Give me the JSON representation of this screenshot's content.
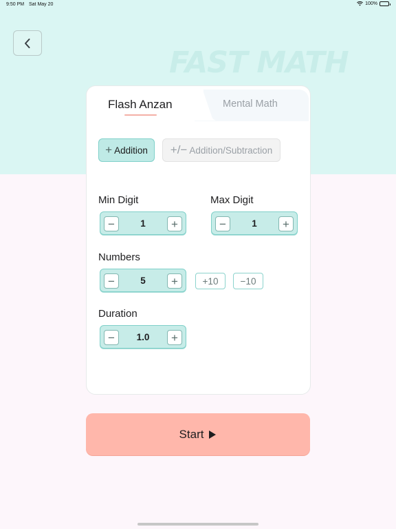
{
  "status_bar": {
    "time": "9:50 PM",
    "date": "Sat May 20",
    "battery": "100%"
  },
  "header": {
    "logo": "FAST MATH"
  },
  "tabs": [
    {
      "label": "Flash Anzan",
      "active": true
    },
    {
      "label": "Mental Math",
      "active": false
    }
  ],
  "modes": {
    "addition": {
      "symbol": "+",
      "label": "Addition",
      "selected": true
    },
    "addition_subtraction": {
      "symbol": "+/−",
      "label": "Addition/Subtraction",
      "selected": false
    }
  },
  "settings": {
    "min_digit": {
      "label": "Min Digit",
      "value": "1"
    },
    "max_digit": {
      "label": "Max Digit",
      "value": "1"
    },
    "numbers": {
      "label": "Numbers",
      "value": "5",
      "plus_ten": "+10",
      "minus_ten": "−10"
    },
    "duration": {
      "label": "Duration",
      "value": "1.0"
    }
  },
  "start": {
    "label": "Start"
  },
  "icons": {
    "back": "chevron-left-icon",
    "play": "play-icon",
    "wifi": "wifi-icon",
    "battery": "battery-icon"
  },
  "colors": {
    "accent_teal": "#7fd0c9",
    "start_button": "#ffb7ab",
    "header_bg": "#daf6f3"
  }
}
